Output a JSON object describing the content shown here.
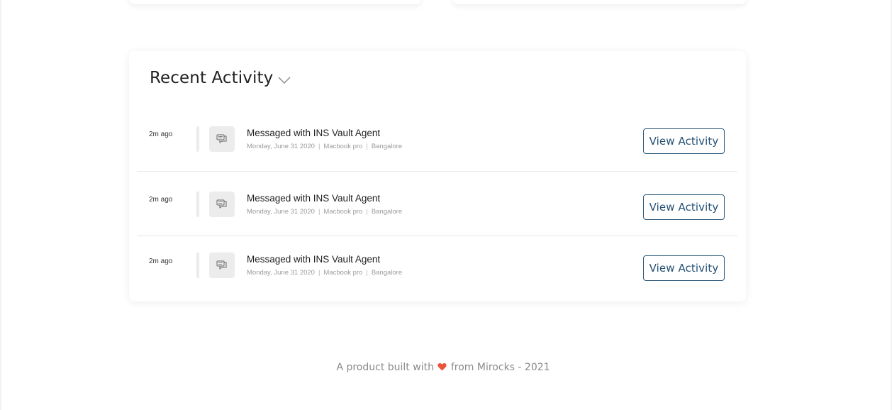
{
  "recent_activity": {
    "title": "Recent Activity",
    "items": [
      {
        "time": "2m ago",
        "title": "Messaged with INS Vault Agent",
        "date": "Monday, June 31 2020",
        "device": "Macbook pro",
        "location": "Bangalore",
        "button_label": "View Activity"
      },
      {
        "time": "2m ago",
        "title": "Messaged with INS Vault Agent",
        "date": "Monday, June 31 2020",
        "device": "Macbook pro",
        "location": "Bangalore",
        "button_label": "View Activity"
      },
      {
        "time": "2m ago",
        "title": "Messaged with INS Vault Agent",
        "date": "Monday, June 31 2020",
        "device": "Macbook pro",
        "location": "Bangalore",
        "button_label": "View Activity"
      }
    ]
  },
  "footer": {
    "prefix": "A product built with",
    "suffix": "from Mirocks - 2021"
  },
  "colors": {
    "accent": "#234f73",
    "heart": "#e8553a"
  },
  "icons": {
    "chevron": "chevron-down-icon",
    "message": "chat-bubbles-icon",
    "heart": "heart-icon"
  }
}
